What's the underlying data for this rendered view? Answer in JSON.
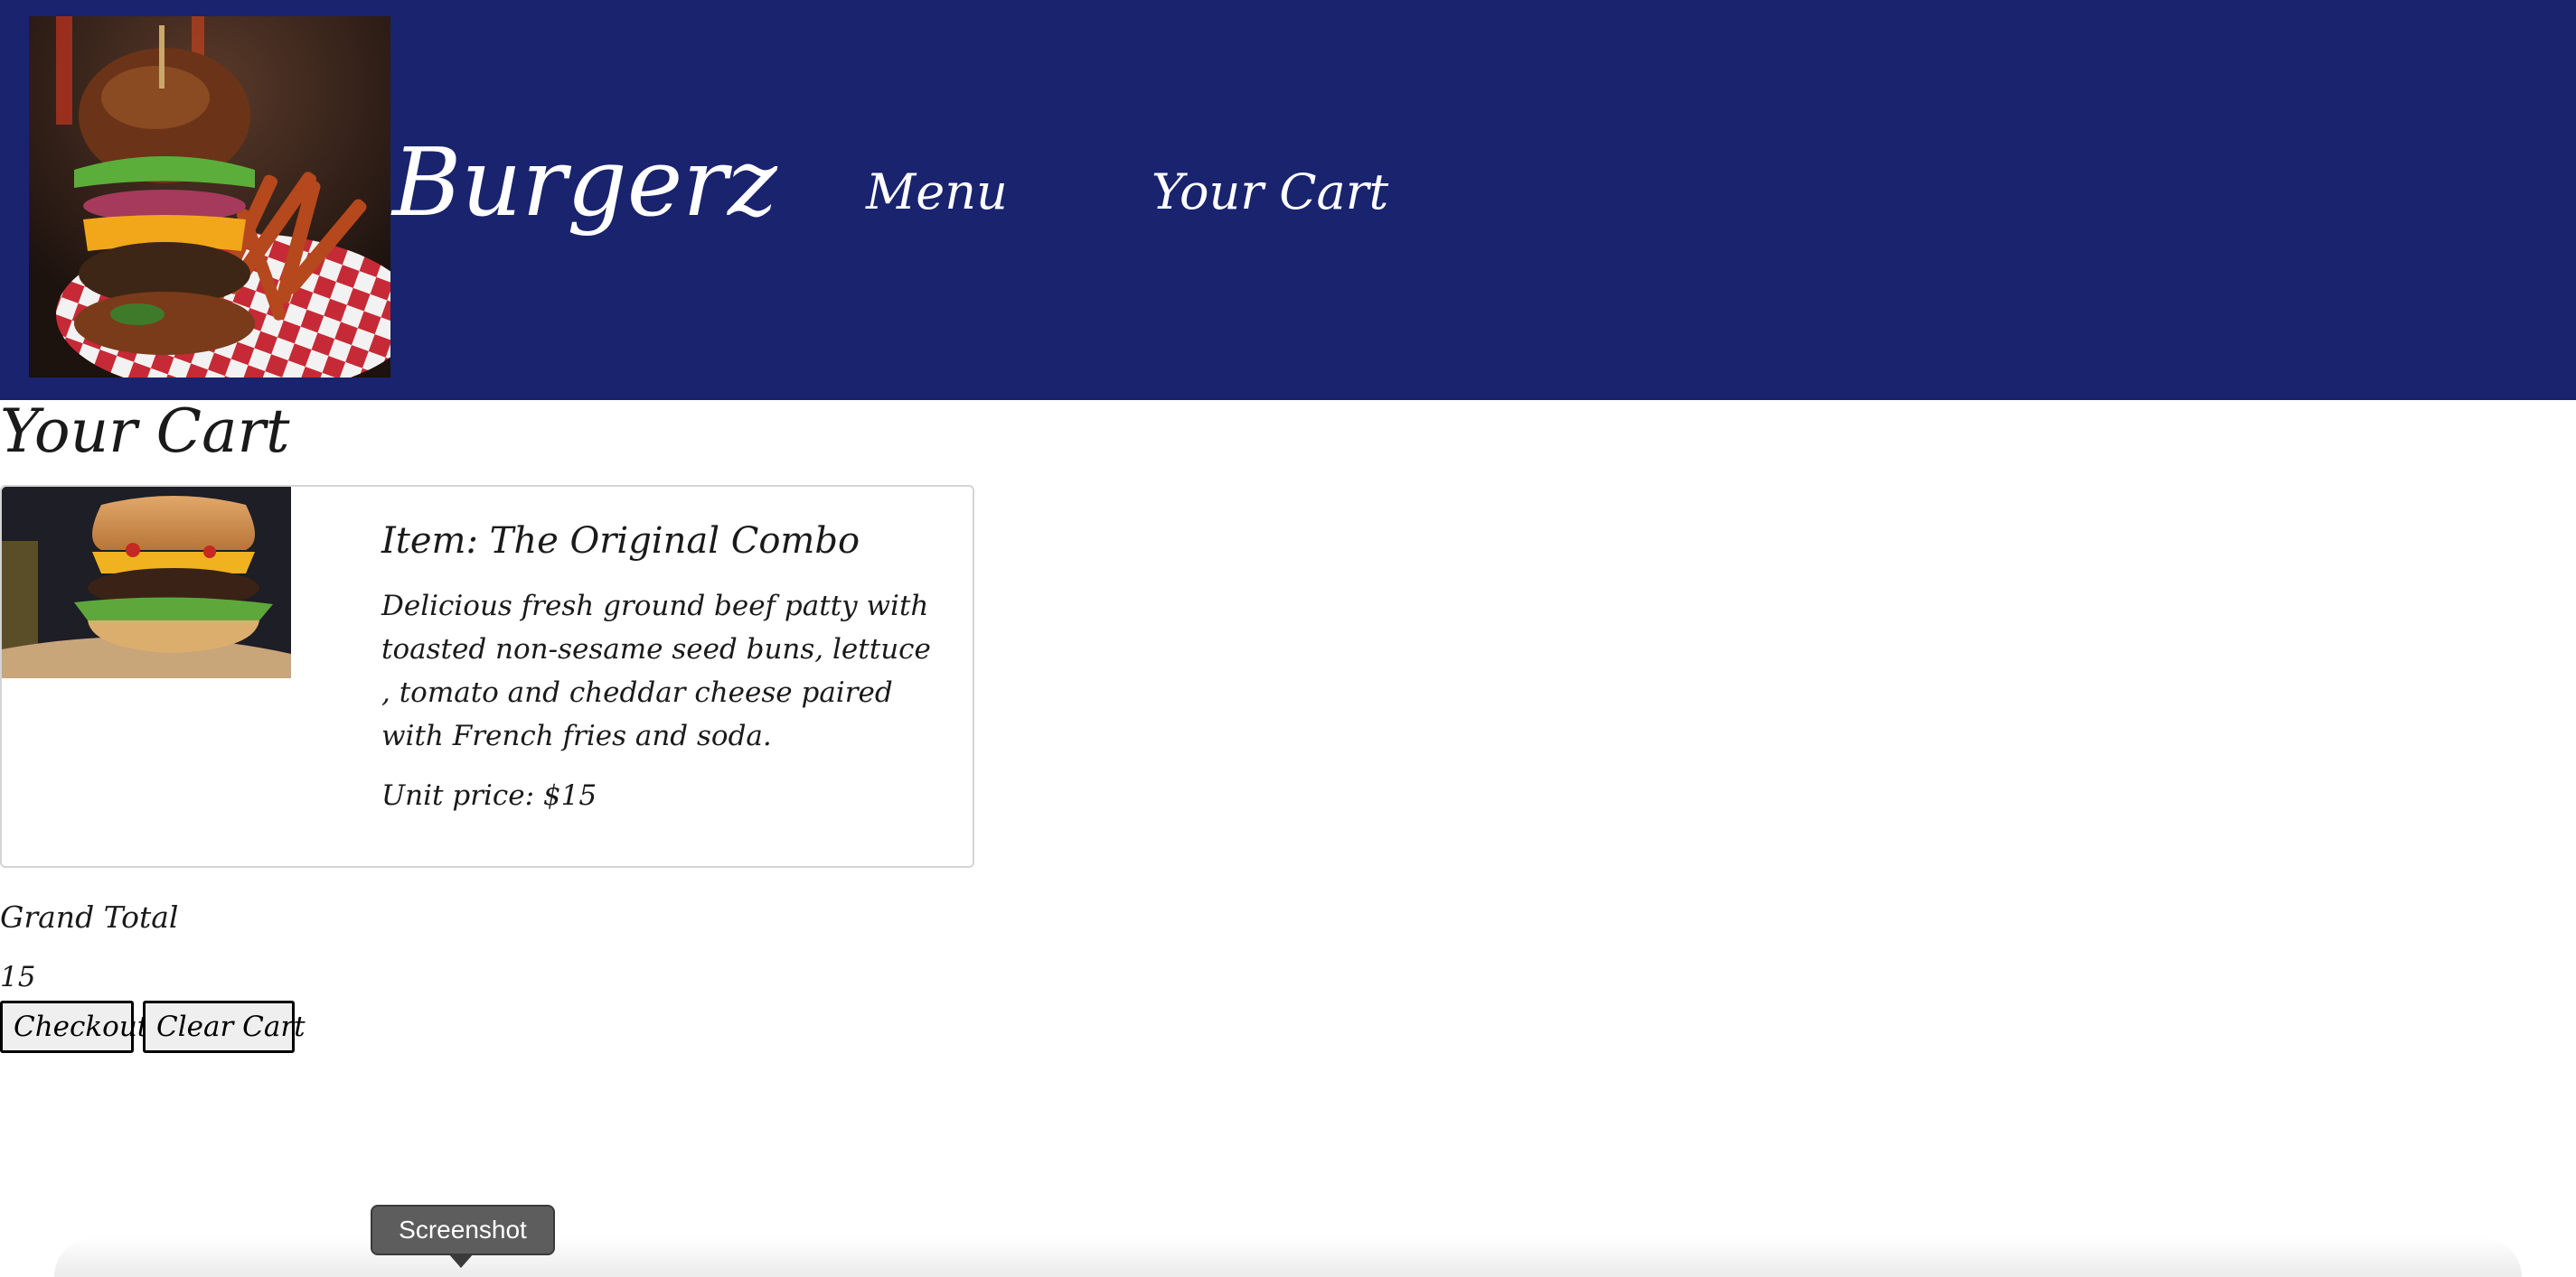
{
  "header": {
    "brand": "Burgerz",
    "nav": [
      {
        "label": "Menu"
      },
      {
        "label": "Your Cart"
      }
    ],
    "logo_icon": "burger-with-fries-photo",
    "background_color": "#19236e"
  },
  "page": {
    "title": "Your Cart"
  },
  "cart": {
    "items": [
      {
        "name": "Item: The Original Combo",
        "description": "Delicious fresh ground beef patty with toasted non-sesame seed buns, lettuce , tomato and cheddar cheese paired with French fries and soda.",
        "unit_price": "Unit price: $15",
        "image_icon": "cheeseburger-photo"
      }
    ],
    "grand_total_label": "Grand Total",
    "grand_total_value": "15",
    "checkout_label": "Checkout",
    "clear_label": "Clear Cart"
  },
  "overlay": {
    "tooltip": "Screenshot"
  }
}
